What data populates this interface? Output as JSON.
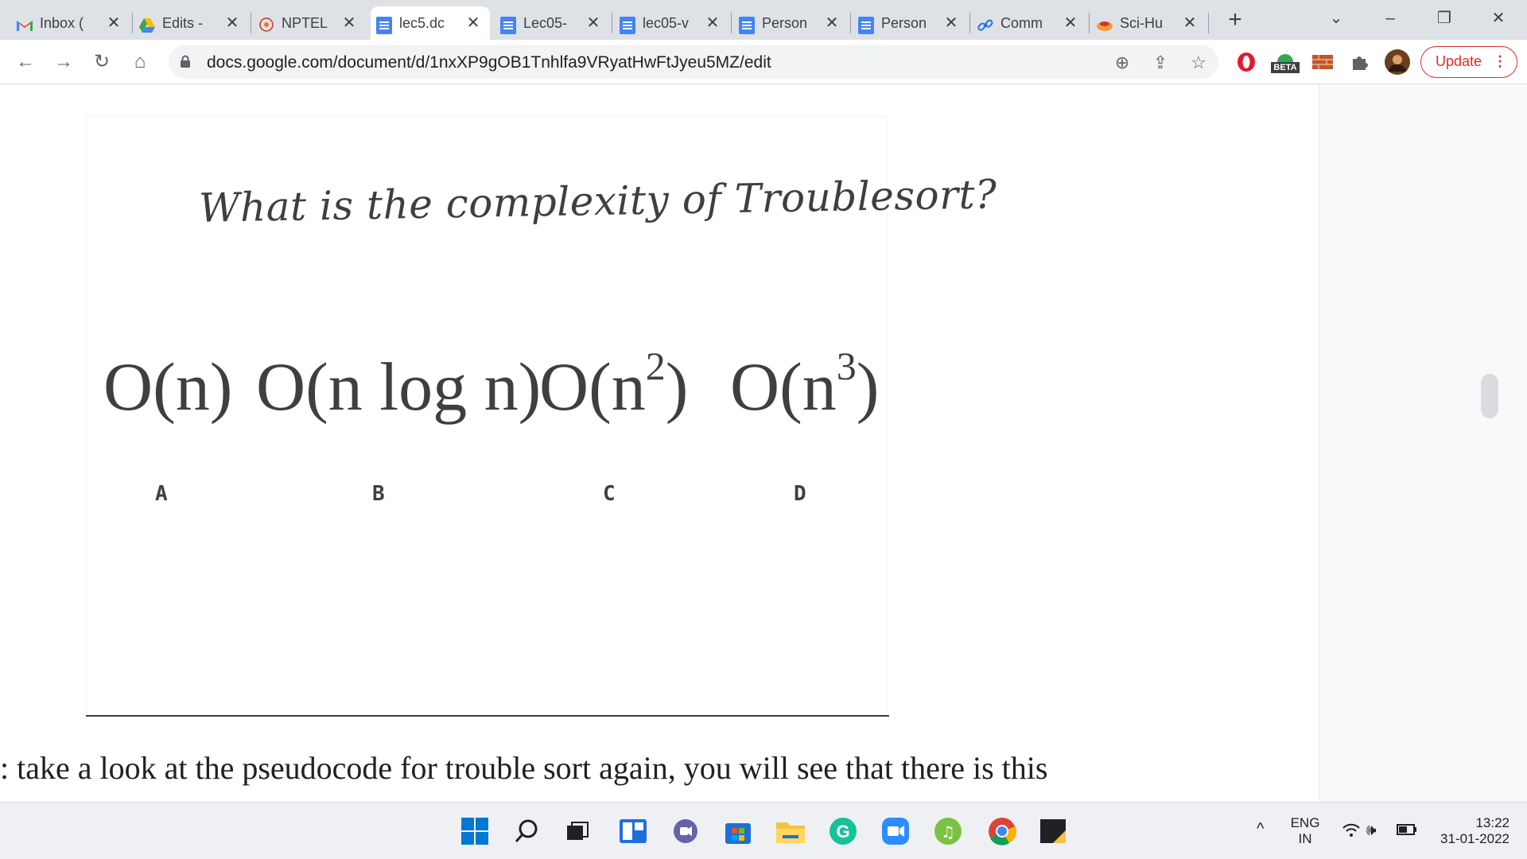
{
  "tabs": [
    {
      "label": "Inbox (",
      "icon": "gmail-icon"
    },
    {
      "label": "Edits -",
      "icon": "google-drive-icon"
    },
    {
      "label": "NPTEL",
      "icon": "nptel-icon"
    },
    {
      "label": "lec5.dc",
      "icon": "google-docs-icon",
      "active": true
    },
    {
      "label": "Lec05-",
      "icon": "google-docs-icon"
    },
    {
      "label": "lec05-v",
      "icon": "google-docs-icon"
    },
    {
      "label": "Person",
      "icon": "google-docs-icon"
    },
    {
      "label": "Person",
      "icon": "google-docs-icon"
    },
    {
      "label": "Comm",
      "icon": "link-icon"
    },
    {
      "label": "Sci-Hu",
      "icon": "scihub-icon"
    }
  ],
  "address_bar": {
    "url": "docs.google.com/document/d/1nxXP9gOB1Tnhlfa9VRyatHwFtJyeu5MZ/edit"
  },
  "toolbar": {
    "update_label": "Update",
    "beta_badge": "BETA"
  },
  "slide": {
    "title": "What is the complexity of Troublesort?",
    "options": [
      {
        "letter": "A",
        "expr": "O(n)"
      },
      {
        "letter": "B",
        "expr": "O(n log n)"
      },
      {
        "letter": "C",
        "expr_base": "O(n",
        "exp": "2",
        "close": ")"
      },
      {
        "letter": "D",
        "expr_base": "O(n",
        "exp": "3",
        "close": ")"
      }
    ]
  },
  "doc_text": ": take a look at the pseudocode for trouble sort again, you will see that there is this",
  "taskbar": {
    "lang_top": "ENG",
    "lang_bottom": "IN",
    "time": "13:22",
    "date": "31-01-2022"
  },
  "colors": {
    "accent_red": "#d93025",
    "docs_blue": "#4285f4",
    "tab_bg": "#dee1e6"
  }
}
